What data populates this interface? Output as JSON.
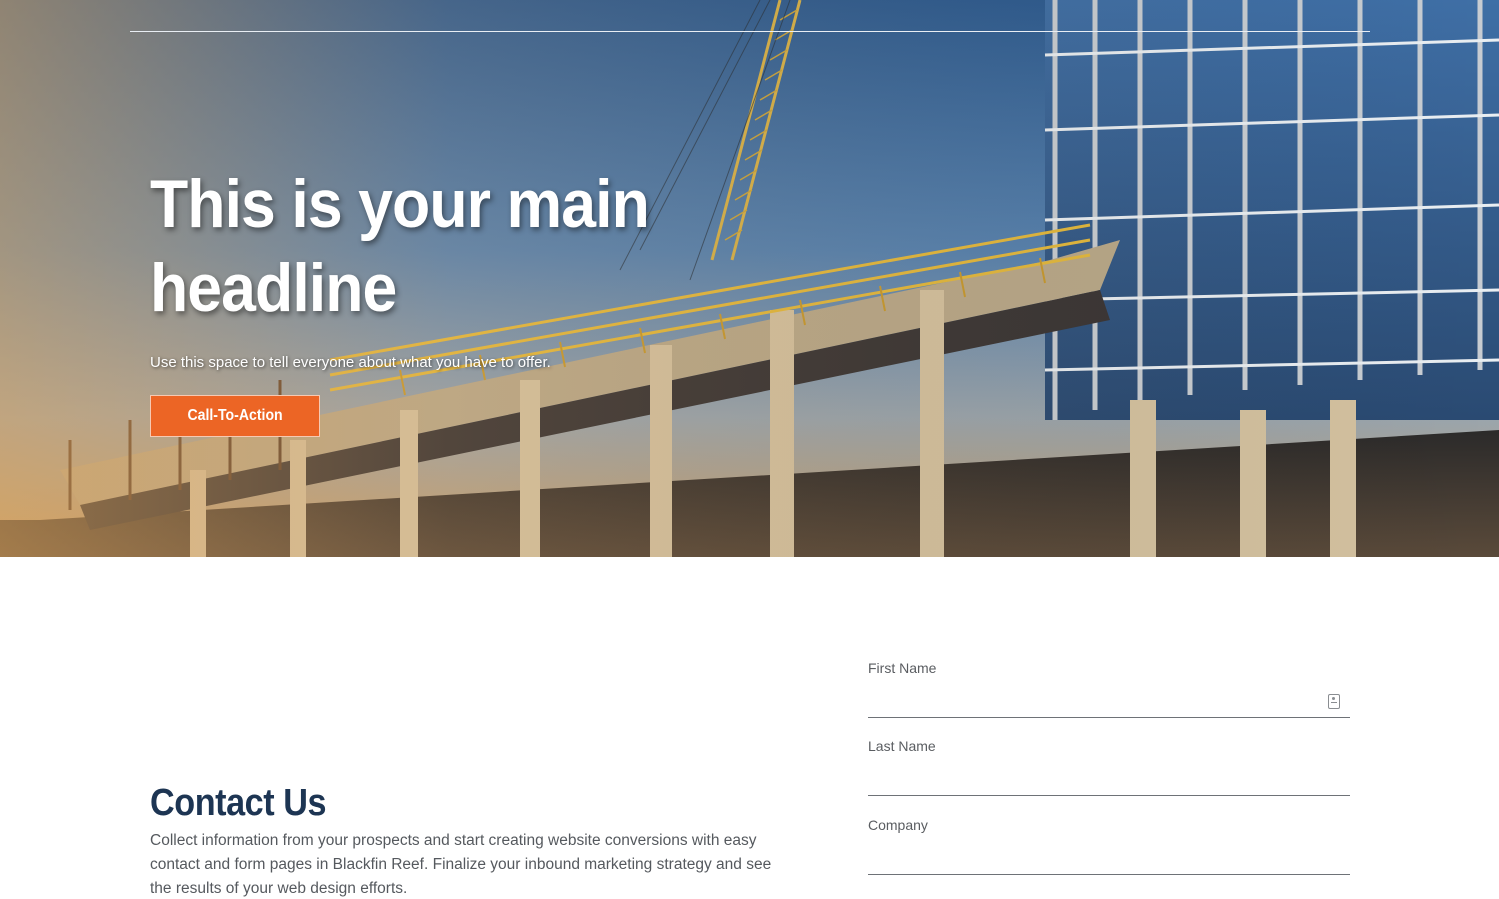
{
  "hero": {
    "headline": "This is your main headline",
    "subtext": "Use this space to tell everyone about what you have to offer.",
    "cta_label": "Call-To-Action",
    "cta_color": "#ec6525",
    "background_image": "construction-site-photo"
  },
  "contact": {
    "title": "Contact Us",
    "body": "Collect information from your prospects and start creating website conversions with easy contact and form pages in Blackfin Reef. Finalize your inbound marketing strategy and see the results of your web design efforts.",
    "title_color": "#1d3553"
  },
  "form": {
    "fields": [
      {
        "label": "First Name",
        "value": "",
        "icon": "contact-card-icon"
      },
      {
        "label": "Last Name",
        "value": ""
      },
      {
        "label": "Company",
        "value": ""
      }
    ]
  }
}
